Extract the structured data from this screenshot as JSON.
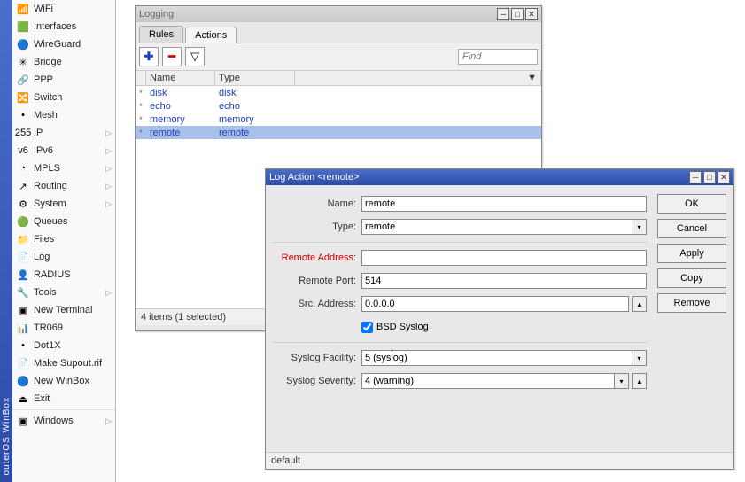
{
  "app": {
    "title": "outerOS WinBox"
  },
  "sidebar": {
    "items": [
      {
        "icon": "📶",
        "label": "WiFi",
        "arrow": false
      },
      {
        "icon": "🟩",
        "label": "Interfaces",
        "arrow": false
      },
      {
        "icon": "🔵",
        "label": "WireGuard",
        "arrow": false
      },
      {
        "icon": "✳",
        "label": "Bridge",
        "arrow": false
      },
      {
        "icon": "🔗",
        "label": "PPP",
        "arrow": false
      },
      {
        "icon": "🔀",
        "label": "Switch",
        "arrow": false
      },
      {
        "icon": "•",
        "label": "Mesh",
        "arrow": false
      },
      {
        "icon": "255",
        "label": "IP",
        "arrow": true
      },
      {
        "icon": "v6",
        "label": "IPv6",
        "arrow": true
      },
      {
        "icon": "◔",
        "label": "MPLS",
        "arrow": true
      },
      {
        "icon": "↗",
        "label": "Routing",
        "arrow": true
      },
      {
        "icon": "⚙",
        "label": "System",
        "arrow": true
      },
      {
        "icon": "🟢",
        "label": "Queues",
        "arrow": false
      },
      {
        "icon": "📁",
        "label": "Files",
        "arrow": false
      },
      {
        "icon": "📄",
        "label": "Log",
        "arrow": false
      },
      {
        "icon": "👤",
        "label": "RADIUS",
        "arrow": false
      },
      {
        "icon": "🔧",
        "label": "Tools",
        "arrow": true
      },
      {
        "icon": "▣",
        "label": "New Terminal",
        "arrow": false
      },
      {
        "icon": "📊",
        "label": "TR069",
        "arrow": false
      },
      {
        "icon": "•",
        "label": "Dot1X",
        "arrow": false
      },
      {
        "icon": "📄",
        "label": "Make Supout.rif",
        "arrow": false
      },
      {
        "icon": "🔵",
        "label": "New WinBox",
        "arrow": false
      },
      {
        "icon": "⏏",
        "label": "Exit",
        "arrow": false
      }
    ],
    "windows_label": "Windows"
  },
  "logwin": {
    "title": "Logging",
    "tabs": [
      "Rules",
      "Actions"
    ],
    "active_tab": 1,
    "find_placeholder": "Find",
    "columns": [
      "",
      "Name",
      "Type",
      ""
    ],
    "rows": [
      {
        "mark": "*",
        "name": "disk",
        "type": "disk",
        "sel": false
      },
      {
        "mark": "*",
        "name": "echo",
        "type": "echo",
        "sel": false
      },
      {
        "mark": "*",
        "name": "memory",
        "type": "memory",
        "sel": false
      },
      {
        "mark": "*",
        "name": "remote",
        "type": "remote",
        "sel": true
      }
    ],
    "status": "4 items (1 selected)"
  },
  "dlg": {
    "title": "Log Action <remote>",
    "buttons": [
      "OK",
      "Cancel",
      "Apply",
      "Copy",
      "Remove"
    ],
    "fields": {
      "name_label": "Name:",
      "name_value": "remote",
      "type_label": "Type:",
      "type_value": "remote",
      "remote_addr_label": "Remote Address:",
      "remote_addr_value": "",
      "remote_port_label": "Remote Port:",
      "remote_port_value": "514",
      "src_addr_label": "Src. Address:",
      "src_addr_value": "0.0.0.0",
      "bsd_label": "BSD Syslog",
      "bsd_checked": true,
      "facility_label": "Syslog Facility:",
      "facility_value": "5 (syslog)",
      "severity_label": "Syslog Severity:",
      "severity_value": "4 (warning)"
    },
    "footer": "default"
  }
}
